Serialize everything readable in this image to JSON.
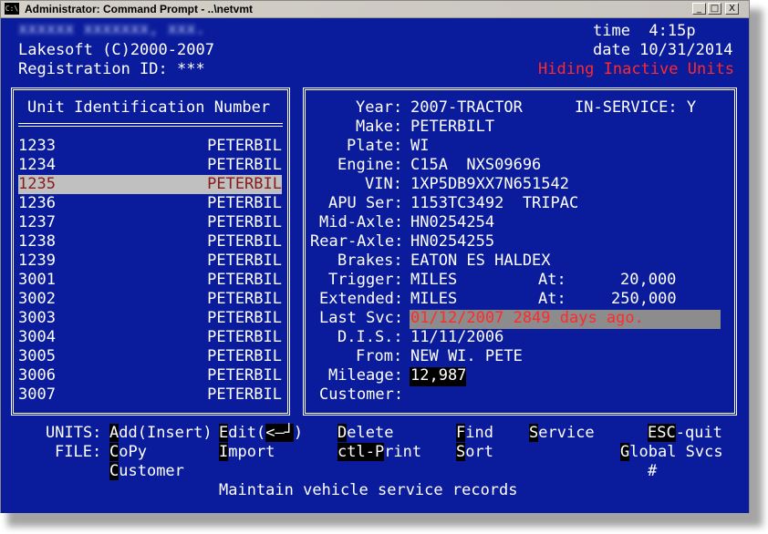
{
  "window": {
    "icon": "C:\\",
    "title": "Administrator: Command Prompt - ..\\netvmt",
    "buttons": {
      "minimize": "_",
      "maximize": "□",
      "close": "X"
    }
  },
  "header": {
    "company": "xxxxxx xxxxxxx, xxx.",
    "copyright": "Lakesoft (C)2000-2007",
    "registration": "Registration ID: ***",
    "time": "time  4:15p",
    "date": "date 10/31/2014",
    "status": "Hiding Inactive Units"
  },
  "unit_list": {
    "heading": "Unit Identification Number",
    "rows": [
      {
        "id": "1233",
        "make": "PETERBIL"
      },
      {
        "id": "1234",
        "make": "PETERBIL"
      },
      {
        "id": "1235",
        "make": "PETERBIL"
      },
      {
        "id": "1236",
        "make": "PETERBIL"
      },
      {
        "id": "1237",
        "make": "PETERBIL"
      },
      {
        "id": "1238",
        "make": "PETERBIL"
      },
      {
        "id": "1239",
        "make": "PETERBIL"
      },
      {
        "id": "3001",
        "make": "PETERBIL"
      },
      {
        "id": "3002",
        "make": "PETERBIL"
      },
      {
        "id": "3003",
        "make": "PETERBIL"
      },
      {
        "id": "3004",
        "make": "PETERBIL"
      },
      {
        "id": "3005",
        "make": "PETERBIL"
      },
      {
        "id": "3006",
        "make": "PETERBIL"
      },
      {
        "id": "3007",
        "make": "PETERBIL"
      }
    ],
    "selected_index": 2
  },
  "details": {
    "year_label": "Year:",
    "year": "2007-TRACTOR",
    "in_service": "IN-SERVICE: Y",
    "make_label": "Make:",
    "make": "PETERBILT",
    "plate_label": "Plate:",
    "plate": "WI",
    "engine_label": "Engine:",
    "engine": "C15A  NXS09696",
    "vin_label": "VIN:",
    "vin": "1XP5DB9XX7N651542",
    "apu_label": "APU Ser:",
    "apu": "1153TC3492  TRIPAC",
    "mid_axle_label": "Mid-Axle:",
    "mid_axle": "HN0254254",
    "rear_axle_label": "Rear-Axle:",
    "rear_axle": "HN0254255",
    "brakes_label": "Brakes:",
    "brakes": "EATON ES HALDEX",
    "trigger_label": "Trigger:",
    "trigger": "MILES",
    "trigger_at_label": "At:",
    "trigger_at": "20,000",
    "extended_label": "Extended:",
    "extended": "MILES",
    "extended_at_label": "At:",
    "extended_at": "250,000",
    "last_svc_label": "Last Svc:",
    "last_svc": "01/12/2007 2849 days ago.",
    "dis_label": "D.I.S.:",
    "dis": "11/11/2006",
    "from_label": "From:",
    "from": "NEW WI. PETE",
    "mileage_label": "Mileage:",
    "mileage": "12,987",
    "customer_label": "Customer:",
    "customer": ""
  },
  "menu": {
    "units_label": "UNITS:",
    "file_label": "FILE:",
    "add": {
      "key": "A",
      "rest": "dd(Insert)"
    },
    "edit": {
      "key": "E",
      "rest": "dit(",
      "enter": "<—┘",
      "close": ")"
    },
    "delete": {
      "key": "D",
      "rest": "elete"
    },
    "find": {
      "key": "F",
      "rest": "ind"
    },
    "service": {
      "key": "S",
      "rest": "ervice"
    },
    "esc_quit": {
      "key": "ESC",
      "rest": "-quit"
    },
    "copy": {
      "key": "C",
      "rest": "oPy"
    },
    "import": {
      "key": "I",
      "rest": "mport"
    },
    "ctl_print": {
      "key": "ctl-P",
      "rest": "rint"
    },
    "sort": {
      "key": "S",
      "rest": "ort"
    },
    "global_svcs": {
      "key": "G",
      "rest": "lobal Svcs"
    },
    "customer": {
      "key": "C",
      "rest": "ustomer"
    },
    "hash": {
      "key": "#",
      "rest": ""
    }
  },
  "footer": {
    "status_line": "Maintain vehicle service records"
  },
  "colors": {
    "console_bg": "#0a1c9c",
    "text": "#ffffff",
    "alert": "#ff2a2a",
    "selection": "#c0c0c0",
    "highlight": "#8c8c8c"
  }
}
